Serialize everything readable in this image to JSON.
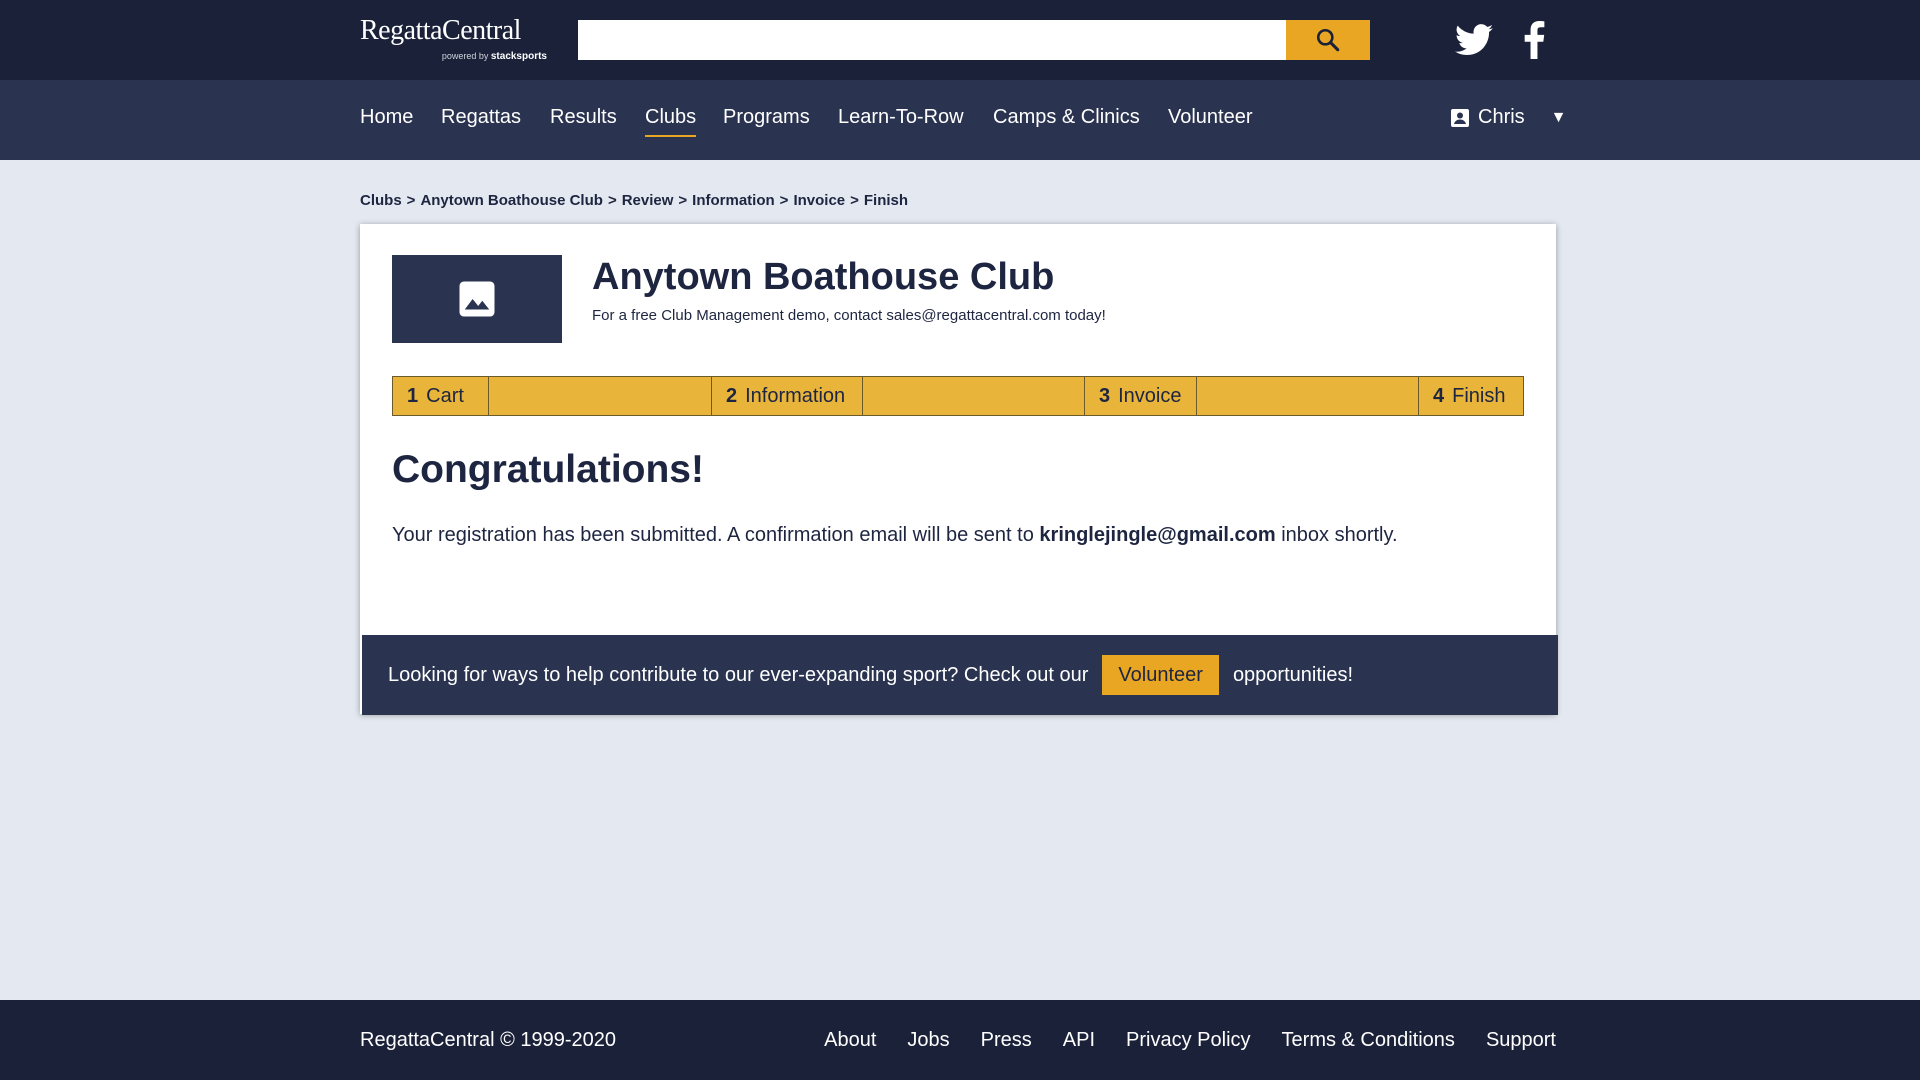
{
  "header": {
    "logo_text": "RegattaCentral",
    "logo_powered_by": "powered by",
    "logo_partner": "stacksports",
    "search": {
      "value": "",
      "placeholder": ""
    },
    "search_icon": "search-icon",
    "social": [
      "twitter-icon",
      "facebook-icon"
    ]
  },
  "nav": {
    "items": [
      {
        "label": "Home"
      },
      {
        "label": "Regattas"
      },
      {
        "label": "Results"
      },
      {
        "label": "Clubs",
        "active": true
      },
      {
        "label": "Programs"
      },
      {
        "label": "Learn-To-Row"
      },
      {
        "label": "Camps & Clinics"
      },
      {
        "label": "Volunteer"
      }
    ],
    "user_name": "Chris",
    "user_icon": "account-box-icon",
    "caret": "▼"
  },
  "breadcrumb": {
    "items": [
      "Clubs",
      "Anytown Boathouse Club",
      "Review",
      "Information",
      "Invoice",
      "Finish"
    ],
    "separator": ">"
  },
  "club": {
    "image_icon": "image-placeholder-icon",
    "name": "Anytown Boathouse Club",
    "subtitle": "For a free Club Management demo, contact sales@regattacentral.com today!"
  },
  "steps": [
    {
      "number": "1",
      "label": "Cart"
    },
    {
      "number": "2",
      "label": "Information"
    },
    {
      "number": "3",
      "label": "Invoice"
    },
    {
      "number": "4",
      "label": "Finish"
    }
  ],
  "confirmation": {
    "heading": "Congratulations!",
    "message_prefix": "Your registration has been submitted. A confirmation email will be sent to ",
    "email": "kringlejingle@gmail.com",
    "message_suffix": " inbox shortly."
  },
  "volunteer_bar": {
    "text_before": "Looking for ways to help contribute to our ever-expanding sport? Check out our",
    "button": "Volunteer",
    "text_after": "opportunities!"
  },
  "footer": {
    "copyright": "RegattaCentral © 1999-2020",
    "links": [
      "About",
      "Jobs",
      "Press",
      "API",
      "Privacy Policy",
      "Terms & Conditions",
      "Support"
    ]
  },
  "colors": {
    "header_bg": "#1b2139",
    "nav_bg": "#2a3350",
    "accent": "#e8a623",
    "page_bg": "#e4e9f1"
  }
}
